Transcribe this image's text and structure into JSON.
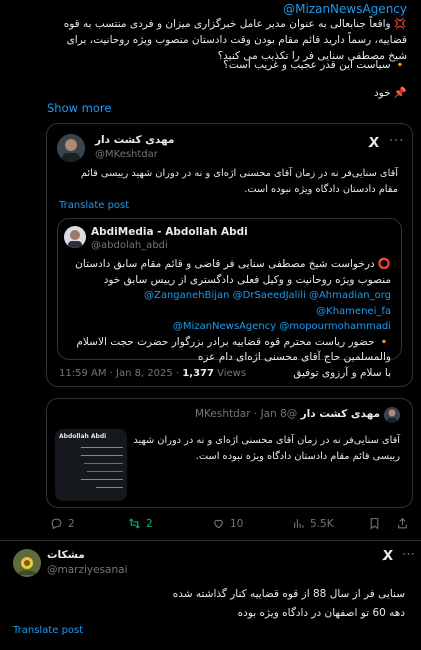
{
  "prev_tweet": {
    "handle": "@MizanNewsAgency",
    "para1": "💢 واقعاً جنابعالی به عنوان مدیر عامل خبرگزاری میزان و فردی منتسب به قوه قضاییه، رسماً دارید قائم مقام بودن وقت دادستان منصوب ویژه روحانیت، برای شیخ مصطفی سنایی فر را تکذیب می کنید؟",
    "para2": "🔸 سیاست این قدر عجیب و غریب است؟",
    "para3": "📌 خود",
    "show_more": "Show more"
  },
  "quote": {
    "name": "مهدی کشت دار",
    "handle": "@MKeshtdar",
    "text": "آقای سنایی‌فر نه در زمان آقای محسنی اژه‌ای و نه در دوران شهید رییسی قائم مقام دادستان دادگاه ویژه نبوده است.",
    "translate": "Translate post",
    "inner": {
      "name": "AbdiMedia - Abdollah Abdi",
      "handle": "@abdolah_abdi",
      "line1": "⭕ درخواست شیخ مصطفی سنایی فر قاضی و قائم مقام سابق دادستان منصوب ویژه روحانیت و وکیل فعلی دادگستری از رییس سابق خود",
      "mentions1": "@ZanganehBijan @DrSaeedJalili @Ahmadian_org @Khamenei_fa",
      "mentions2": "@MizanNewsAgency @mopourmohammadi",
      "line2": "🔸 حضور ریاست محترم قوه قضاییه برادر بزرگوار حضرت حجت الاسلام والمسلمین حاج آقای محسنی اژه‌ای دام عزه",
      "line3": "با سلام و آرزوی توفیق"
    },
    "time": "11:59 AM · Jan 8, 2025 · ",
    "views_count": "1,377",
    "views_label": " Views"
  },
  "quote2": {
    "name": "مهدی کشت دار",
    "handle": "@MKeshtdar",
    "date": "Jan 8",
    "text": "آقای سنایی‌فر نه در زمان آقای محسنی اژه‌ای و نه در دوران شهید رییسی قائم مقام دادستان دادگاه ویژه نبوده است.",
    "thumb_title": "Abdollah Abdi"
  },
  "actions": {
    "replies": "2",
    "reposts": "2",
    "likes": "10",
    "views": "5.5K"
  },
  "reply": {
    "name": "مشکات",
    "handle": "@marziyesanai",
    "line1": "سنایی فر از سال 88 از قوه قضاییه کنار گذاشته شده",
    "line2": "دهه 60 تو اصفهان در دادگاه ویژه بوده",
    "translate": "Translate post"
  },
  "colors": {
    "accent": "#1d9bf0",
    "muted": "#71767b",
    "repost": "#00ba7c",
    "bg": "#000000"
  }
}
